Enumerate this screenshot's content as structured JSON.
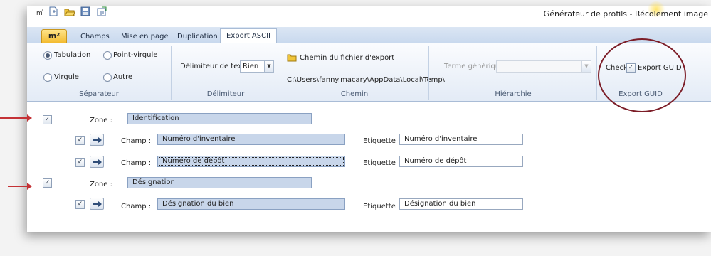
{
  "window": {
    "title": "Générateur de profils - Récolement image"
  },
  "quick_access": [
    "m-icon",
    "new-doc-icon",
    "open-folder-icon",
    "save-icon",
    "export-icon"
  ],
  "ribbon": {
    "app_button": "m²",
    "tabs": [
      "Champs",
      "Mise en page",
      "Duplication",
      "Export ASCII"
    ],
    "active_tab": "Export ASCII",
    "separateur": {
      "title": "Séparateur",
      "tabulation": "Tabulation",
      "point_virgule": "Point-virgule",
      "virgule": "Virgule",
      "autre": "Autre",
      "selected": "Tabulation"
    },
    "delimiteur": {
      "title": "Délimiteur",
      "label": "Délimiteur de texte",
      "value": "Rien"
    },
    "chemin": {
      "title": "Chemin",
      "button": "Chemin du fichier d'export",
      "path": "C:\\Users\\fanny.macary\\AppData\\Local\\Temp\\"
    },
    "hierarchie": {
      "title": "Hiérarchie",
      "label": "Terme générique",
      "value": ""
    },
    "export_guid": {
      "title": "Export GUID",
      "check_label": "Check",
      "checkbox_label": "Export GUID",
      "checked": true
    }
  },
  "labels": {
    "zone": "Zone :",
    "champ": "Champ :",
    "etiquette": "Etiquette"
  },
  "zones": [
    {
      "name": "Identification",
      "checked": true,
      "fields": [
        {
          "champ": "Numéro d'inventaire",
          "etiquette": "Numéro d'inventaire",
          "checked": true
        },
        {
          "champ": "Numéro de dépôt",
          "etiquette": "Numéro de dépôt",
          "checked": true
        }
      ]
    },
    {
      "name": "Désignation",
      "checked": true,
      "fields": [
        {
          "champ": "Désignation du bien",
          "etiquette": "Désignation du bien",
          "checked": true
        }
      ]
    }
  ],
  "colors": {
    "annotation": "#c43236",
    "circle": "#7c1d27",
    "field_fill": "#c8d6ea"
  }
}
